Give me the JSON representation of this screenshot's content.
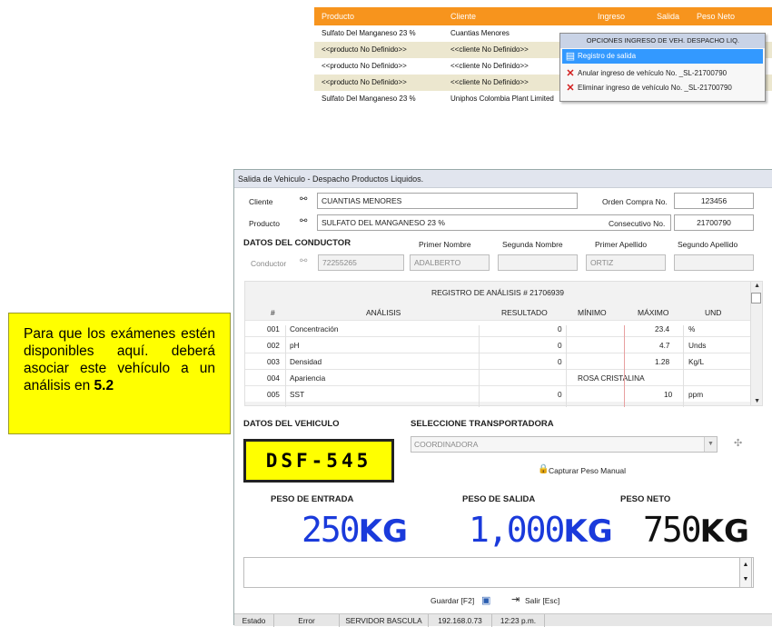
{
  "top_grid": {
    "headers": [
      "Producto",
      "Cliente",
      "Ingreso",
      "Salida",
      "Peso Neto"
    ],
    "rows": [
      {
        "producto": "Sulfato Del Manganeso 23 %",
        "cliente": "Cuantias Menores"
      },
      {
        "producto": "<<producto No Definido>>",
        "cliente": "<<cliente No Definido>>"
      },
      {
        "producto": "<<producto No Definido>>",
        "cliente": "<<cliente No Definido>>"
      },
      {
        "producto": "<<producto No Definido>>",
        "cliente": "<<cliente No Definido>>"
      },
      {
        "producto": "Sulfato Del Manganeso 23 %",
        "cliente": "Uniphos Colombia Plant Limited"
      }
    ]
  },
  "context_menu": {
    "title": "OPCIONES INGRESO DE VEH. DESPACHO LIQ.",
    "items": [
      {
        "label": "Registro de salida",
        "icon": "register-icon"
      },
      {
        "label": "Anular ingreso de vehículo No. _SL-21700790",
        "icon": "x-icon"
      },
      {
        "label": "Eliminar ingreso de vehículo No. _SL-21700790",
        "icon": "x-icon"
      }
    ]
  },
  "note": {
    "text": "Para que los exámenes estén disponibles aquí. deberá asociar este vehículo a un análisis en ",
    "bold": "5.2"
  },
  "dialog": {
    "title": "Salida de Vehiculo - Despacho Productos Liquidos.",
    "cliente_label": "Cliente",
    "cliente_value": "CUANTIAS MENORES",
    "producto_label": "Producto",
    "producto_value": "SULFATO DEL MANGANESO 23 %",
    "orden_label": "Orden Compra No.",
    "orden_value": "123456",
    "consecutivo_label": "Consecutivo No.",
    "consecutivo_value": "21700790",
    "conductor_section": "DATOS DEL CONDUCTOR",
    "name_headers": [
      "Primer Nombre",
      "Segunda Nombre",
      "Primer Apellido",
      "Segundo Apellido"
    ],
    "conductor_label": "Conductor",
    "conductor_id": "72255265",
    "primer_nombre": "ADALBERTO",
    "segundo_nombre": "",
    "primer_apellido": "ORTIZ",
    "segundo_apellido": ""
  },
  "analysis": {
    "caption": "REGISTRO DE ANÁLISIS # 21706939",
    "headers": [
      "#",
      "ANÁLISIS",
      "RESULTADO",
      "MÍNIMO",
      "MÁXIMO",
      "UND"
    ],
    "rows": [
      {
        "num": "001",
        "name": "Concentración",
        "result": "0",
        "min": "",
        "max": "23.4",
        "und": "%"
      },
      {
        "num": "002",
        "name": "pH",
        "result": "0",
        "min": "",
        "max": "4.7",
        "und": "Unds"
      },
      {
        "num": "003",
        "name": "Densidad",
        "result": "0",
        "min": "",
        "max": "1.28",
        "und": "Kg/L"
      },
      {
        "num": "004",
        "name": "Apariencia",
        "result": "",
        "min": "",
        "max": "",
        "und": "",
        "span": "ROSA CRISTALINA"
      },
      {
        "num": "005",
        "name": "SST",
        "result": "0",
        "min": "",
        "max": "10",
        "und": "ppm"
      }
    ]
  },
  "vehicle": {
    "section": "DATOS DEL VEHICULO",
    "plate": "DSF-545",
    "transp_section": "SELECCIONE TRANSPORTADORA",
    "transportadora": "COORDINADORA",
    "capturar_label": "Capturar Peso Manual"
  },
  "weights": {
    "entrada_label": "PESO DE ENTRADA",
    "entrada_num": "250",
    "entrada_unit": "KG",
    "salida_label": "PESO DE SALIDA",
    "salida_num": "1,000",
    "salida_unit": "KG",
    "neto_label": "PESO NETO",
    "neto_num": "750",
    "neto_unit": "KG"
  },
  "buttons": {
    "guardar": "Guardar [F2]",
    "salir": "Salir [Esc]"
  },
  "status": {
    "estado": "Estado",
    "error": "Error",
    "servidor": "SERVIDOR BASCULA",
    "ip": "192.168.0.73",
    "time": "12:23 p.m."
  },
  "colors": {
    "orange": "#f7941d",
    "blue": "#1a3adb",
    "yellow": "#ffff00"
  }
}
